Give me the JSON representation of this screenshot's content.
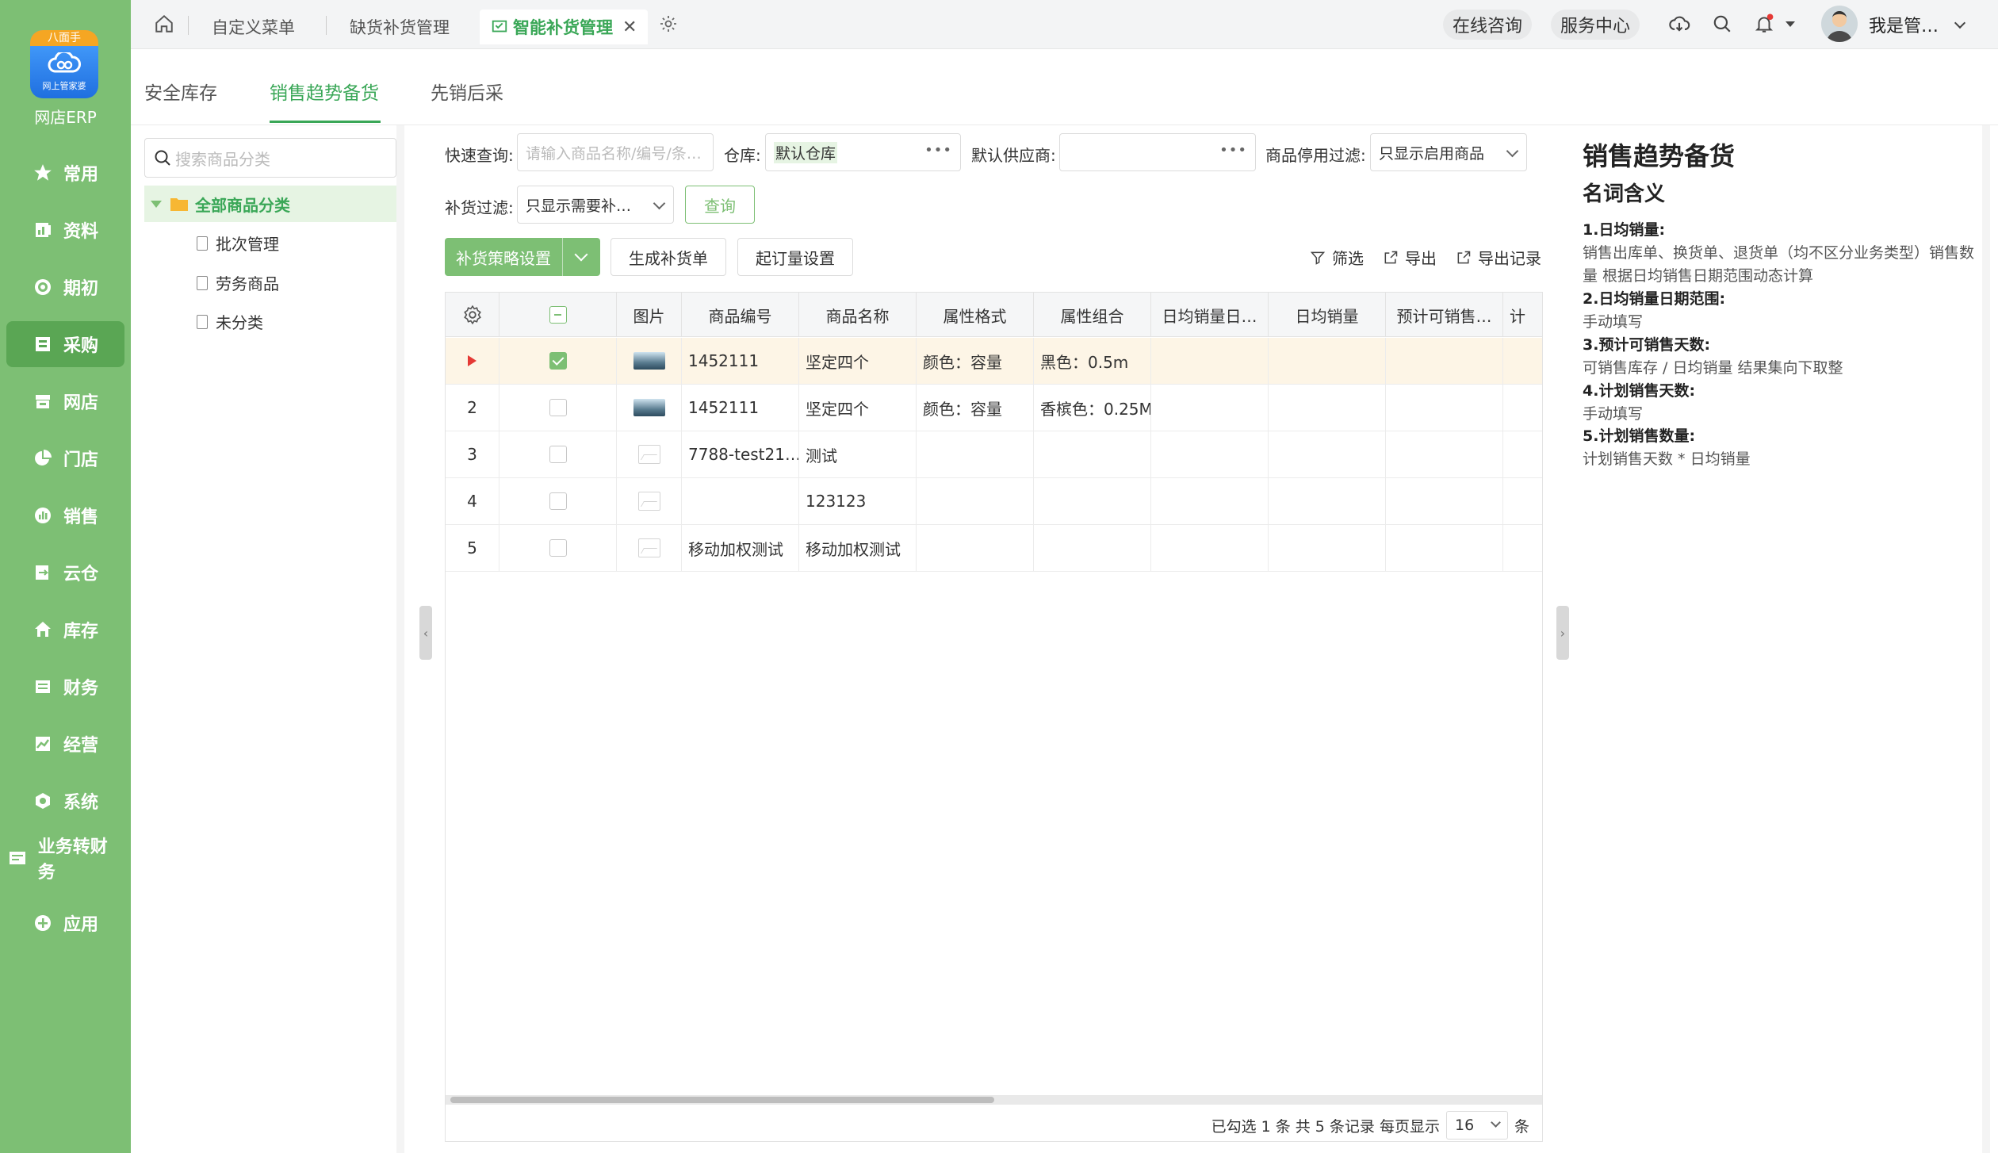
{
  "app": {
    "logo_ribbon": "八面手",
    "logo_small": "网上管家婆",
    "name": "网店ERP"
  },
  "nav": [
    {
      "label": "常用",
      "icon": "star-icon"
    },
    {
      "label": "资料",
      "icon": "doc-chart-icon"
    },
    {
      "label": "期初",
      "icon": "target-icon"
    },
    {
      "label": "采购",
      "icon": "cart-icon",
      "active": true
    },
    {
      "label": "网店",
      "icon": "store-icon"
    },
    {
      "label": "门店",
      "icon": "pie-icon"
    },
    {
      "label": "销售",
      "icon": "bar-chart-icon"
    },
    {
      "label": "云仓",
      "icon": "warehouse-in-icon"
    },
    {
      "label": "库存",
      "icon": "house-icon"
    },
    {
      "label": "财务",
      "icon": "wallet-icon"
    },
    {
      "label": "经营",
      "icon": "trend-icon"
    },
    {
      "label": "系统",
      "icon": "hexagon-gear-icon"
    },
    {
      "label": "业务转财务",
      "icon": "transfer-icon"
    },
    {
      "label": "应用",
      "icon": "plus-icon"
    }
  ],
  "topbar": {
    "tabs": [
      "自定义菜单",
      "缺货补货管理",
      "智能补货管理"
    ],
    "online_consult": "在线咨询",
    "service_center": "服务中心",
    "user_name": "我是管…"
  },
  "subtabs": [
    "安全库存",
    "销售趋势备货",
    "先销后采"
  ],
  "tree": {
    "search_placeholder": "搜索商品分类",
    "root": "全部商品分类",
    "children": [
      "批次管理",
      "劳务商品",
      "未分类"
    ]
  },
  "filters": {
    "quick_label": "快速查询:",
    "quick_placeholder": "请输入商品名称/编号/条…",
    "warehouse_label": "仓库:",
    "warehouse_value": "默认仓库",
    "supplier_label": "默认供应商:",
    "supplier_value": "",
    "disable_label": "商品停用过滤:",
    "disable_value": "只显示启用商品",
    "restock_label": "补货过滤:",
    "restock_value": "只显示需要补…",
    "query_btn": "查询"
  },
  "toolbar": {
    "strategy_btn": "补货策略设置",
    "generate_btn": "生成补货单",
    "moq_btn": "起订量设置",
    "filter": "筛选",
    "export": "导出",
    "export_log": "导出记录"
  },
  "table": {
    "columns": [
      "图片",
      "商品编号",
      "商品名称",
      "属性格式",
      "属性组合",
      "日均销量日…",
      "日均销量",
      "预计可销售…",
      "计"
    ],
    "rows": [
      {
        "idx": "",
        "checked": true,
        "img": "photo",
        "code": "1452111",
        "name": "坚定四个",
        "format": "颜色：容量",
        "combo": "黑色：0.5m"
      },
      {
        "idx": "2",
        "checked": false,
        "img": "photo",
        "code": "1452111",
        "name": "坚定四个",
        "format": "颜色：容量",
        "combo": "香槟色：0.25M"
      },
      {
        "idx": "3",
        "checked": false,
        "img": "placeholder",
        "code": "7788-test21…",
        "name": "测试",
        "format": "",
        "combo": ""
      },
      {
        "idx": "4",
        "checked": false,
        "img": "placeholder",
        "code": "",
        "name": "123123",
        "format": "",
        "combo": ""
      },
      {
        "idx": "5",
        "checked": false,
        "img": "placeholder",
        "code": "移动加权测试",
        "name": "移动加权测试",
        "format": "",
        "combo": ""
      }
    ]
  },
  "pager": {
    "summary": "已勾选 1 条  共 5 条记录  每页显示",
    "page_size": "16",
    "unit": "条"
  },
  "help": {
    "title": "销售趋势备货",
    "subtitle": "名词含义",
    "items": [
      {
        "term": "1.日均销量:",
        "desc": "销售出库单、换货单、退货单（均不区分业务类型）销售数量 根据日均销售日期范围动态计算"
      },
      {
        "term": "2.日均销量日期范围:",
        "desc": "手动填写"
      },
      {
        "term": "3.预计可销售天数:",
        "desc": "可销售库存 / 日均销量 结果集向下取整"
      },
      {
        "term": "4.计划销售天数:",
        "desc": "手动填写"
      },
      {
        "term": "5.计划销售数量:",
        "desc": "计划销售天数 * 日均销量"
      }
    ]
  },
  "colors": {
    "brand_green": "#7dbf74",
    "active_text": "#3aa757",
    "selected_row": "#fdf5e6"
  }
}
